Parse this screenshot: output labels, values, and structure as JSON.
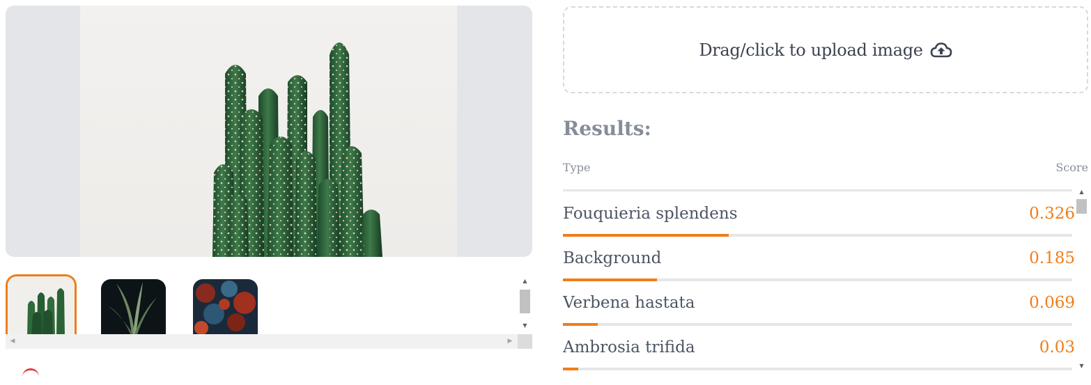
{
  "preview": {
    "image": "cactus-photo"
  },
  "gallery": {
    "thumbnails": [
      {
        "name": "thumbnail-cactus",
        "selected": true
      },
      {
        "name": "thumbnail-dark-plant",
        "selected": false
      },
      {
        "name": "thumbnail-red-blue-foliage",
        "selected": false
      }
    ],
    "scroll_icons": {
      "up": "▲",
      "down": "▼",
      "left": "◀",
      "right": "▶"
    }
  },
  "upload": {
    "label": "Drag/click to upload image",
    "icon": "cloud-upload-icon"
  },
  "results": {
    "title": "Results:",
    "columns": {
      "type": "Type",
      "score": "Score"
    },
    "items": [
      {
        "type": "Fouquieria splendens",
        "score": "0.326",
        "value": 0.326
      },
      {
        "type": "Background",
        "score": "0.185",
        "value": 0.185
      },
      {
        "type": "Verbena hastata",
        "score": "0.069",
        "value": 0.069
      },
      {
        "type": "Ambrosia trifida",
        "score": "0.03",
        "value": 0.03
      }
    ]
  },
  "colors": {
    "accent": "#f07d19",
    "muted_text": "#868d99",
    "body_text": "#4b5563",
    "track": "#e5e6e8"
  }
}
